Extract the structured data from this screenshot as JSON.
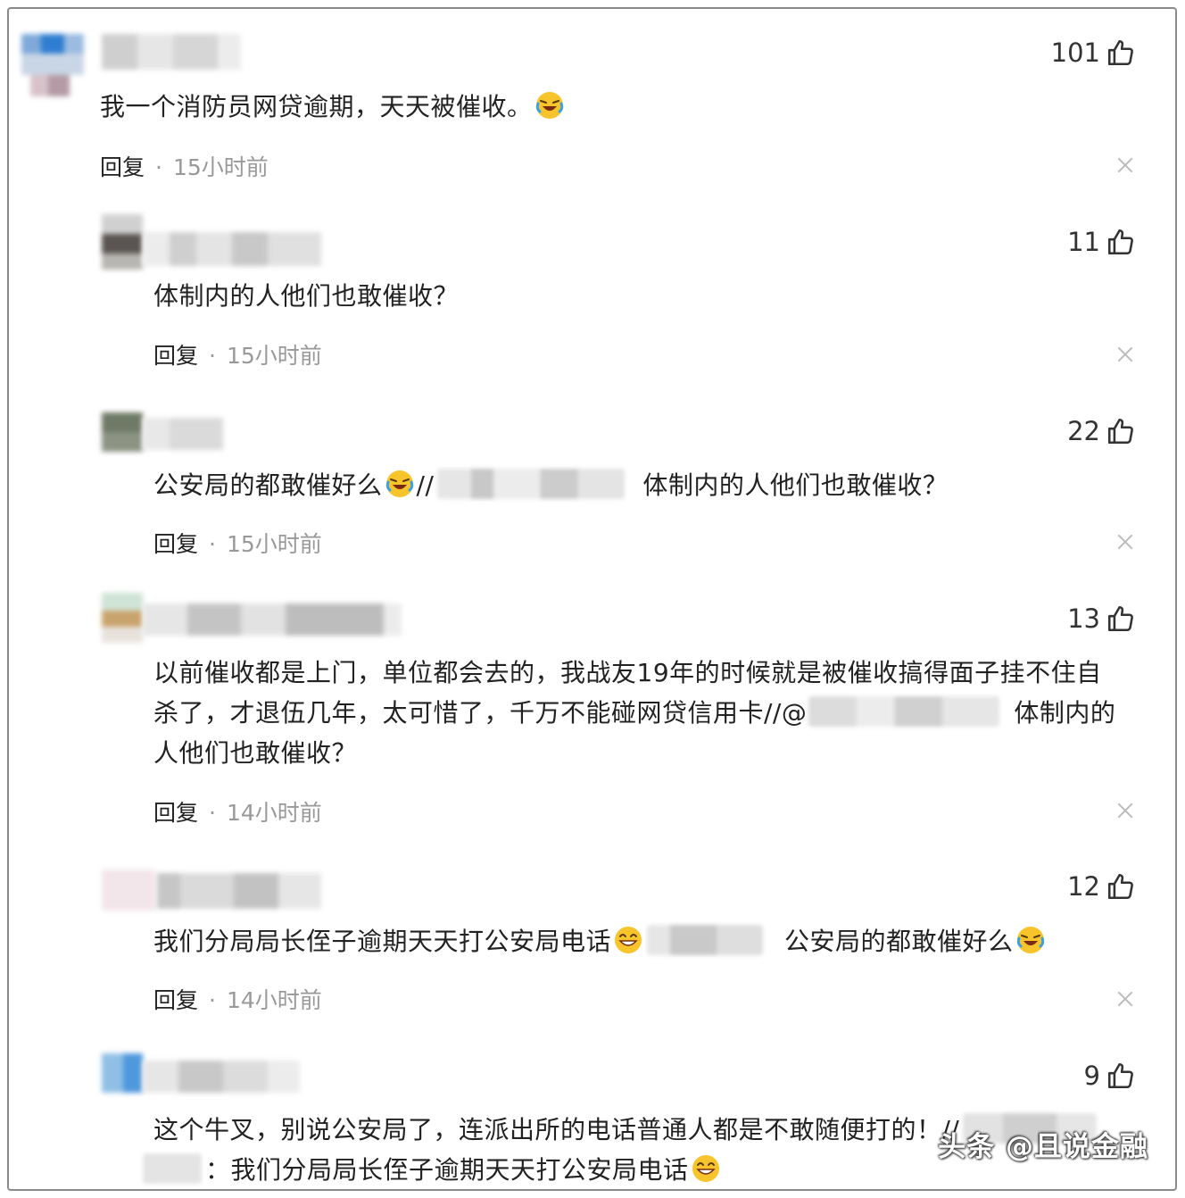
{
  "comments": [
    {
      "likes": "101",
      "text": "我一个消防员网贷逾期，天天被催收。",
      "reply": "回复",
      "time": "15小时前"
    },
    {
      "likes": "11",
      "text": "体制内的人他们也敢催收？",
      "reply": "回复",
      "time": "15小时前"
    },
    {
      "likes": "22",
      "text_a": "公安局的都敢催好么",
      "text_b": "//",
      "text_c": "体制内的人他们也敢催收？",
      "reply": "回复",
      "time": "15小时前"
    },
    {
      "likes": "13",
      "line1": "以前催收都是上门，单位都会去的，我战友19年的时候就是被催收搞得面子挂不住自",
      "line2a": "杀了，才退伍几年，太可惜了，千万不能碰网贷信用卡//@",
      "line2b": "体制内的",
      "line3": "人他们也敢催收？",
      "reply": "回复",
      "time": "14小时前"
    },
    {
      "likes": "12",
      "text_a": "我们分局局长侄子逾期天天打公安局电话",
      "text_c": "公安局的都敢催好么",
      "reply": "回复",
      "time": "14小时前"
    },
    {
      "likes": "9",
      "line1": "这个牛叉，别说公安局了，连派出所的电话普通人都是不敢随便打的！//",
      "line2": "：我们分局局长侄子逾期天天打公安局电话"
    }
  ],
  "watermark": "头条 @且说金融",
  "icons": {
    "like": "thumbs-up-icon",
    "close": "close-icon",
    "emoji_cry": "laugh-cry-emoji-icon",
    "emoji_grin": "grin-emoji-icon"
  }
}
